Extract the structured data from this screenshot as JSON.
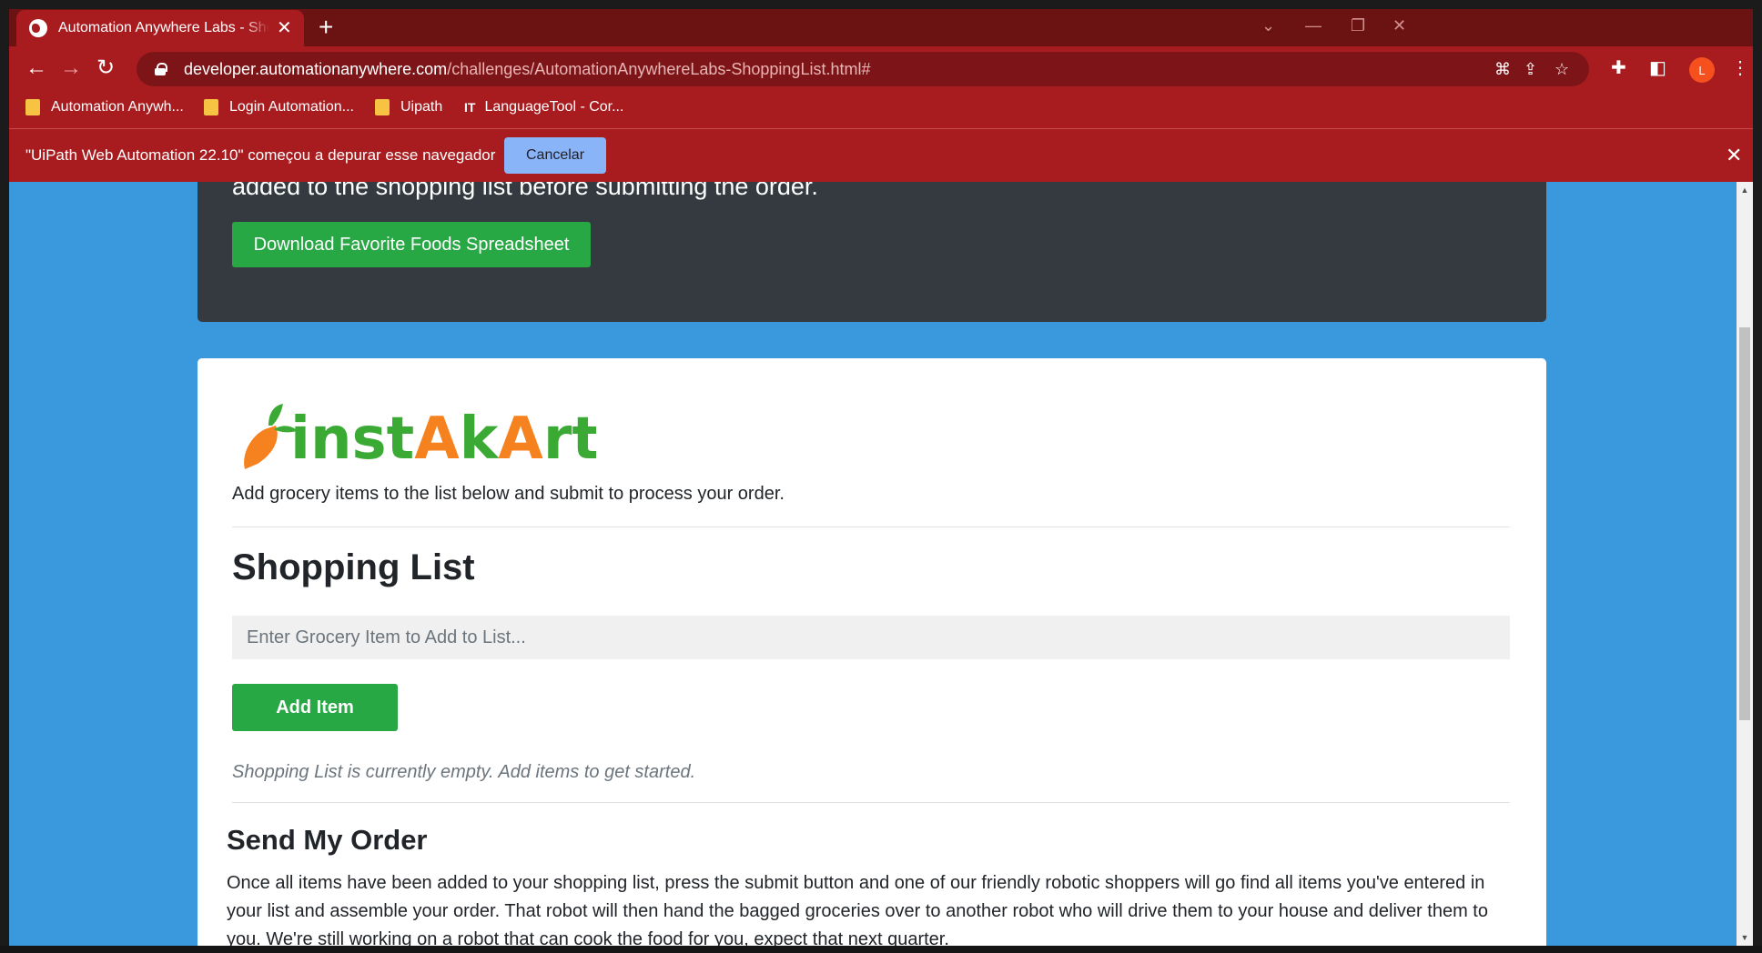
{
  "browser": {
    "tab_title": "Automation Anywhere Labs - Shopping List",
    "new_tab_symbol": "+",
    "url_host": "developer.automationanywhere.com",
    "url_path": "/challenges/AutomationAnywhereLabs-ShoppingList.html#",
    "profile_initial": "L",
    "bookmarks": [
      "Automation Anywh...",
      "Login Automation...",
      "Uipath",
      "LanguageTool - Cor..."
    ],
    "infobar_text": "\"UiPath Web Automation 22.10\" começou a depurar esse navegador",
    "infobar_cancel": "Cancelar"
  },
  "page": {
    "dark_card_text": "added to the shopping list before submitting the order.",
    "download_button": "Download Favorite Foods Spreadsheet",
    "logo_text": "instAkArt",
    "intro": "Add grocery items to the list below and submit to process your order.",
    "shopping_heading": "Shopping List",
    "input_placeholder": "Enter Grocery Item to Add to List...",
    "add_button": "Add Item",
    "empty_message": "Shopping List is currently empty. Add items to get started.",
    "send_heading": "Send My Order",
    "send_description": "Once all items have been added to your shopping list, press the submit button and one of our friendly robotic shoppers will go find all items you've entered in your list and assemble your order. That robot will then hand the bagged groceries over to another robot who will drive them to your house and deliver them to you. We're still working on a robot that can cook the food for you, expect that next quarter."
  },
  "colors": {
    "chrome_red": "#a81c1f",
    "page_blue": "#3a98dc",
    "success_green": "#28a745",
    "dark_card": "#343a40",
    "logo_green": "#3aaa35",
    "logo_orange": "#f5821f"
  }
}
